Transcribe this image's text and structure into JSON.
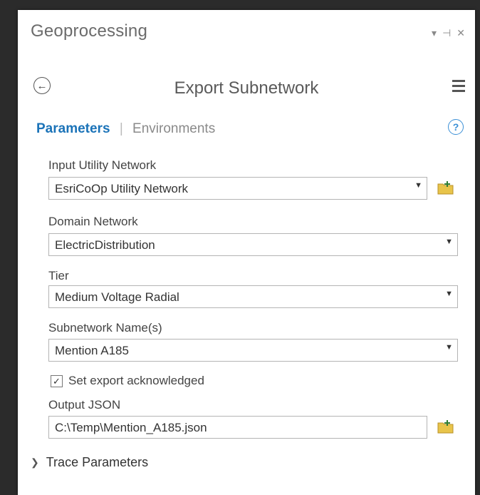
{
  "pane": {
    "title": "Geoprocessing",
    "controls": [
      "▾",
      "⊣",
      "✕"
    ]
  },
  "tool": {
    "title": "Export Subnetwork"
  },
  "tabs": {
    "parameters": "Parameters",
    "separator": "|",
    "environments": "Environments"
  },
  "params": {
    "input_network": {
      "label": "Input Utility Network",
      "value": "EsriCoOp Utility Network"
    },
    "domain_network": {
      "label": "Domain Network",
      "value": "ElectricDistribution"
    },
    "tier": {
      "label": "Tier",
      "value": "Medium Voltage Radial"
    },
    "subnetwork": {
      "label": "Subnetwork Name(s)",
      "value": "Mention A185"
    },
    "set_export": {
      "label": "Set export acknowledged",
      "checked": true
    },
    "output_json": {
      "label": "Output JSON",
      "value": "C:\\Temp\\Mention_A185.json"
    }
  },
  "trace": {
    "label": "Trace Parameters"
  },
  "colors": {
    "accent": "#1b73b8",
    "folder": "#e8c44a"
  }
}
